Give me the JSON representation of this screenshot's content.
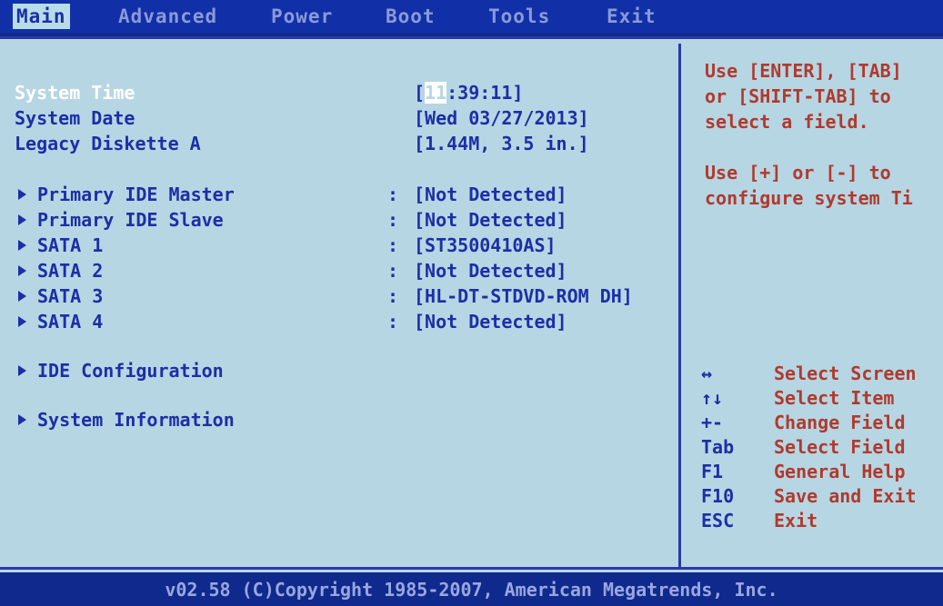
{
  "menu": {
    "tabs": [
      "Main",
      "Advanced",
      "Power",
      "Boot",
      "Tools",
      "Exit"
    ]
  },
  "main": {
    "system_time": {
      "label": "System Time",
      "value_hour": "11",
      "value_rest": ":39:11]"
    },
    "system_date": {
      "label": "System Date",
      "value": "[Wed 03/27/2013]"
    },
    "diskette": {
      "label": "Legacy Diskette A",
      "value": "[1.44M, 3.5 in.]"
    },
    "devices": [
      {
        "label": "Primary IDE Master",
        "value": "[Not Detected]"
      },
      {
        "label": "Primary IDE Slave",
        "value": "[Not Detected]"
      },
      {
        "label": "SATA 1",
        "value": "[ST3500410AS]"
      },
      {
        "label": "SATA 2",
        "value": "[Not Detected]"
      },
      {
        "label": "SATA 3",
        "value": "[HL-DT-STDVD-ROM DH]"
      },
      {
        "label": "SATA 4",
        "value": "[Not Detected]"
      }
    ],
    "ide_config": "IDE Configuration",
    "system_info": "System Information"
  },
  "help": {
    "lines1": [
      "Use [ENTER], [TAB]",
      "or [SHIFT-TAB] to",
      "select a field."
    ],
    "lines2": [
      "Use [+] or [-] to",
      "configure system Ti"
    ]
  },
  "keys": [
    {
      "key": "↔",
      "desc": "Select Screen"
    },
    {
      "key": "↑↓",
      "desc": "Select Item"
    },
    {
      "key": "+-",
      "desc": "Change Field"
    },
    {
      "key": "Tab",
      "desc": "Select Field"
    },
    {
      "key": "F1",
      "desc": "General Help"
    },
    {
      "key": "F10",
      "desc": "Save and Exit"
    },
    {
      "key": "ESC",
      "desc": "Exit"
    }
  ],
  "footer": "v02.58 (C)Copyright 1985-2007, American Megatrends, Inc.",
  "colors": {
    "background": "#b6d6e3",
    "frame": "#0f2a8c",
    "text": "#1c2fa6",
    "help_text": "#b03a2e",
    "highlight": "#ffffff"
  }
}
